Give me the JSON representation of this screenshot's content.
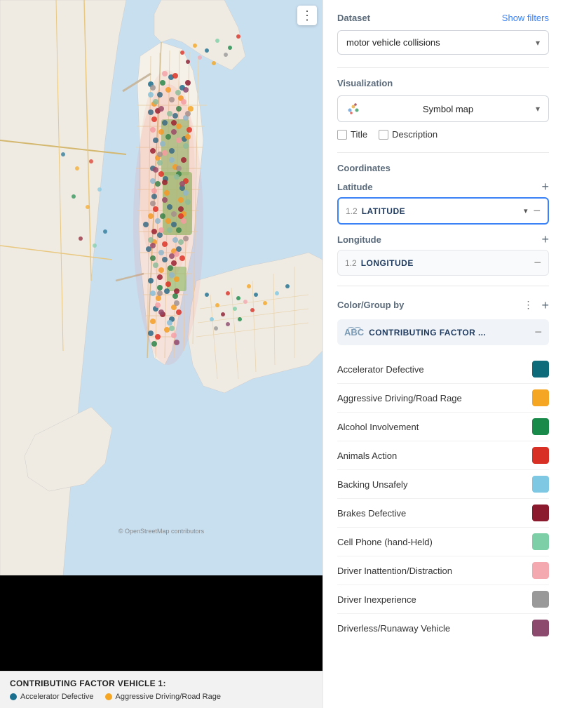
{
  "map": {
    "more_button_label": "⋮",
    "legend_title": "CONTRIBUTING FACTOR VEHICLE 1:",
    "legend_items": [
      {
        "label": "Accelerator Defective",
        "color": "#1a6e8e"
      },
      {
        "label": "Aggressive Driving/Road Rage",
        "color": "#f5a623"
      }
    ]
  },
  "right_panel": {
    "dataset_label": "Dataset",
    "show_filters_label": "Show filters",
    "dataset_value": "motor vehicle collisions",
    "visualization_label": "Visualization",
    "viz_value": "Symbol map",
    "title_checkbox": "Title",
    "description_checkbox": "Description",
    "coordinates_label": "Coordinates",
    "latitude_label": "Latitude",
    "latitude_field_num": "1.2",
    "latitude_field_name": "LATITUDE",
    "longitude_label": "Longitude",
    "longitude_field_num": "1.2",
    "longitude_field_name": "LONGITUDE",
    "color_group_label": "Color/Group by",
    "contributing_factor_name": "CONTRIBUTING FACTOR ...",
    "color_items": [
      {
        "label": "Accelerator Defective",
        "color": "#0e6b7a"
      },
      {
        "label": "Aggressive Driving/Road Rage",
        "color": "#f5a623"
      },
      {
        "label": "Alcohol Involvement",
        "color": "#1a8a4a"
      },
      {
        "label": "Animals Action",
        "color": "#d93025"
      },
      {
        "label": "Backing Unsafely",
        "color": "#7ec8e3"
      },
      {
        "label": "Brakes Defective",
        "color": "#8b1a2e"
      },
      {
        "label": "Cell Phone (hand-Held)",
        "color": "#7dcfa8"
      },
      {
        "label": "Driver Inattention/Distraction",
        "color": "#f4a8b0"
      },
      {
        "label": "Driver Inexperience",
        "color": "#999999"
      },
      {
        "label": "Driverless/Runaway Vehicle",
        "color": "#8b4a6e"
      }
    ]
  }
}
